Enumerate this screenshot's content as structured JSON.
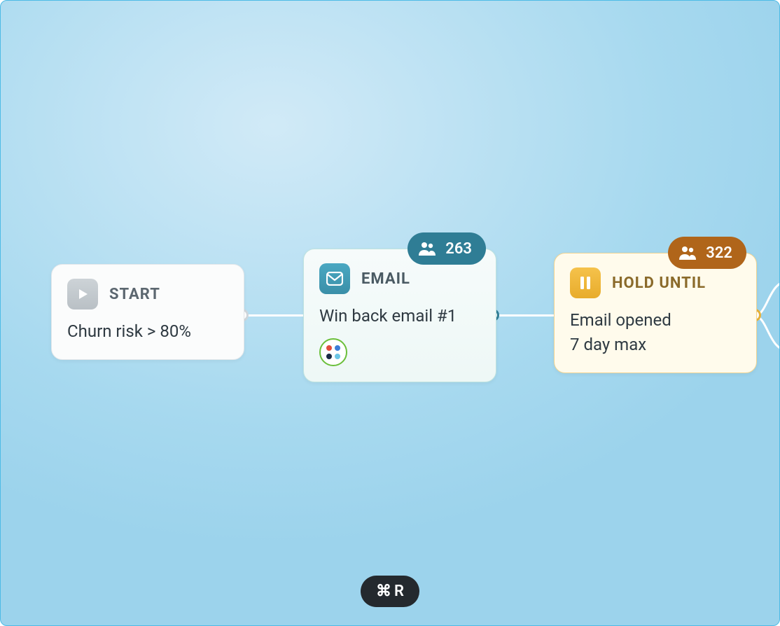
{
  "nodes": {
    "start": {
      "title": "START",
      "description": "Churn risk > 80%"
    },
    "email": {
      "title": "EMAIL",
      "description": "Win back email #1",
      "count": "263"
    },
    "hold": {
      "title": "HOLD UNTIL",
      "line1": "Email opened",
      "line2": "7 day max",
      "count": "322"
    }
  },
  "shortcut": {
    "symbol": "⌘",
    "key": "R"
  }
}
